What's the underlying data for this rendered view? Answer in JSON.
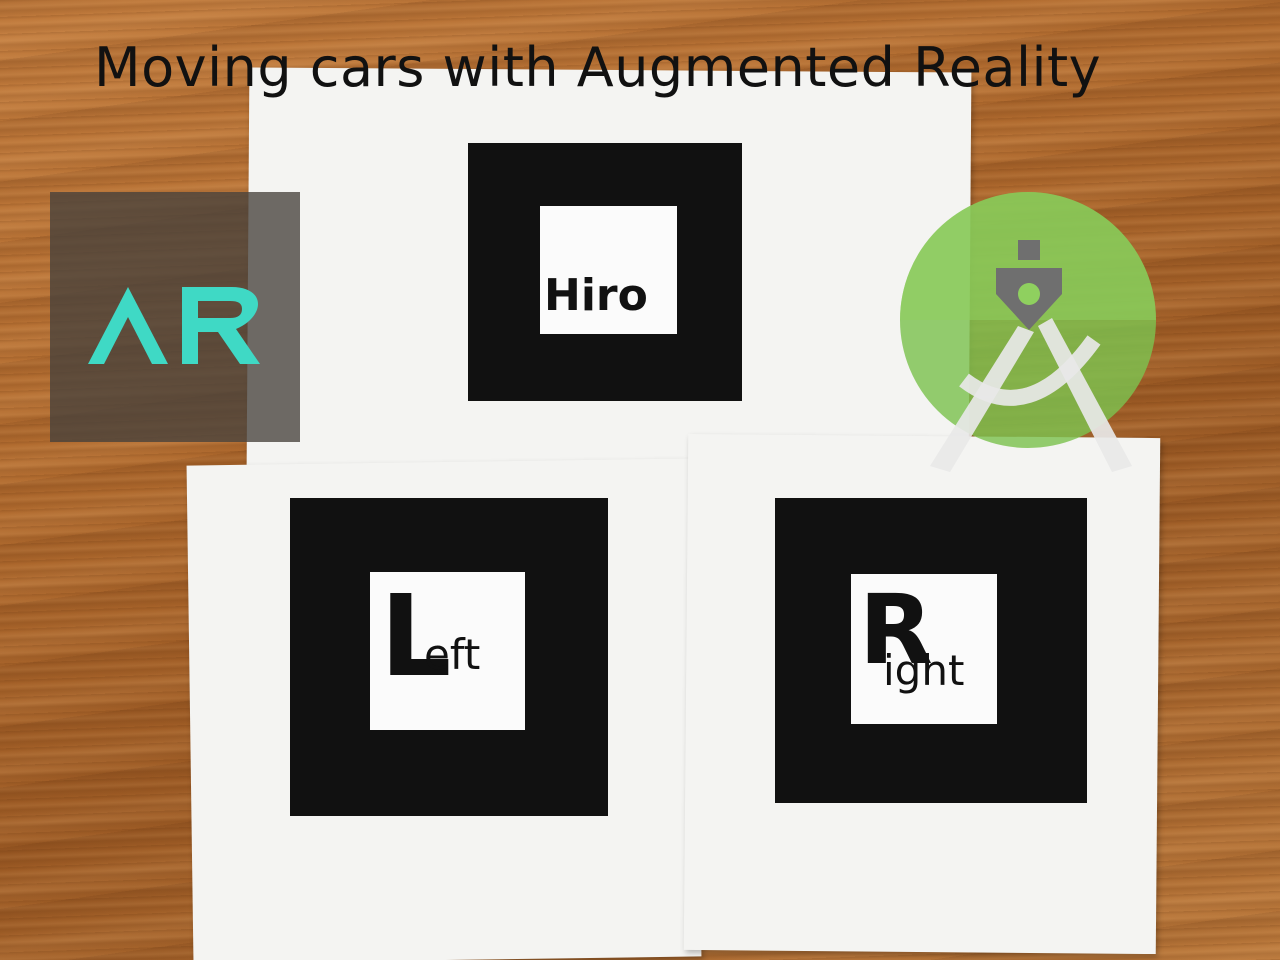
{
  "title": "Moving cars with Augmented Reality",
  "ar_logo": {
    "text": "AR",
    "color": "#3fd9c5"
  },
  "android_logo": {
    "name": "android-studio-icon",
    "color": "#7cc24f"
  },
  "markers": {
    "hiro": {
      "text": "Hiro"
    },
    "left": {
      "big": "L",
      "rest": "eft"
    },
    "right": {
      "big": "R",
      "rest": "ight"
    }
  }
}
